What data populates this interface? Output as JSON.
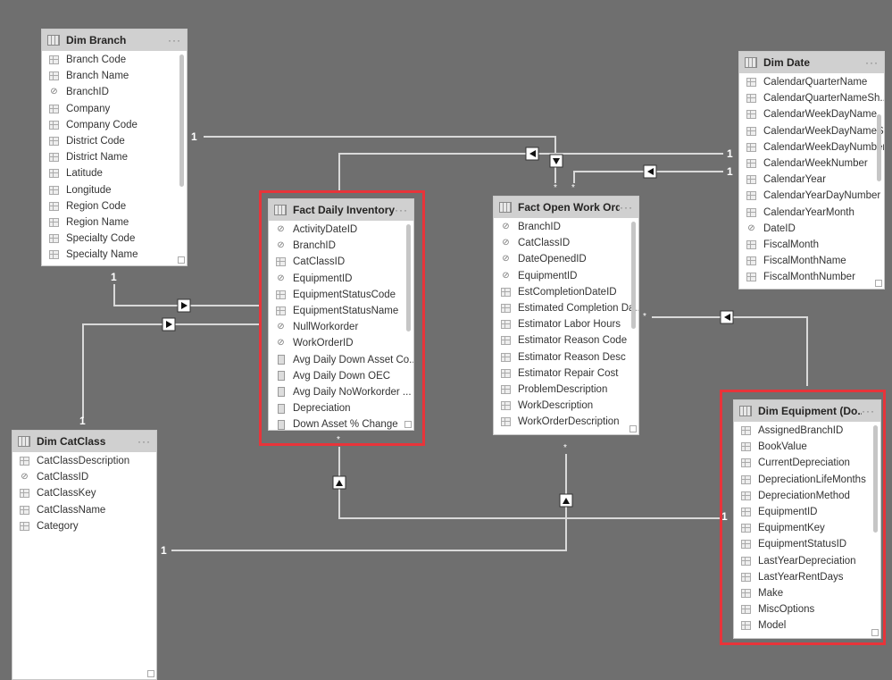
{
  "tables": {
    "dim_branch": {
      "title": "Dim Branch",
      "fields": [
        {
          "name": "Branch Code",
          "icon": "col"
        },
        {
          "name": "Branch Name",
          "icon": "col"
        },
        {
          "name": "BranchID",
          "icon": "hidden"
        },
        {
          "name": "Company",
          "icon": "col"
        },
        {
          "name": "Company Code",
          "icon": "col"
        },
        {
          "name": "District Code",
          "icon": "col"
        },
        {
          "name": "District Name",
          "icon": "col"
        },
        {
          "name": "Latitude",
          "icon": "col"
        },
        {
          "name": "Longitude",
          "icon": "col"
        },
        {
          "name": "Region Code",
          "icon": "col"
        },
        {
          "name": "Region Name",
          "icon": "col"
        },
        {
          "name": "Specialty Code",
          "icon": "col"
        },
        {
          "name": "Specialty Name",
          "icon": "col"
        }
      ]
    },
    "fact_daily_inventory": {
      "title": "Fact Daily Inventory",
      "highlighted": true,
      "fields": [
        {
          "name": "ActivityDateID",
          "icon": "hidden"
        },
        {
          "name": "BranchID",
          "icon": "hidden"
        },
        {
          "name": "CatClassID",
          "icon": "col"
        },
        {
          "name": "EquipmentID",
          "icon": "hidden"
        },
        {
          "name": "EquipmentStatusCode",
          "icon": "col"
        },
        {
          "name": "EquipmentStatusName",
          "icon": "col"
        },
        {
          "name": "NullWorkorder",
          "icon": "hidden"
        },
        {
          "name": "WorkOrderID",
          "icon": "hidden"
        },
        {
          "name": "Avg Daily Down Asset Co...",
          "icon": "measure"
        },
        {
          "name": "Avg Daily Down OEC",
          "icon": "measure"
        },
        {
          "name": "Avg Daily NoWorkorder ...",
          "icon": "measure"
        },
        {
          "name": "Depreciation",
          "icon": "measure"
        },
        {
          "name": "Down Asset % Change",
          "icon": "measure"
        }
      ]
    },
    "fact_open_work_orders": {
      "title": "Fact Open Work Ord...",
      "fields": [
        {
          "name": "BranchID",
          "icon": "hidden"
        },
        {
          "name": "CatClassID",
          "icon": "hidden"
        },
        {
          "name": "DateOpenedID",
          "icon": "hidden"
        },
        {
          "name": "EquipmentID",
          "icon": "hidden"
        },
        {
          "name": "EstCompletionDateID",
          "icon": "col"
        },
        {
          "name": "Estimated Completion Da...",
          "icon": "col"
        },
        {
          "name": "Estimator Labor Hours",
          "icon": "col"
        },
        {
          "name": "Estimator Reason Code",
          "icon": "col"
        },
        {
          "name": "Estimator Reason Desc",
          "icon": "col"
        },
        {
          "name": "Estimator Repair Cost",
          "icon": "col"
        },
        {
          "name": "ProblemDescription",
          "icon": "col"
        },
        {
          "name": "WorkDescription",
          "icon": "col"
        },
        {
          "name": "WorkOrderDescription",
          "icon": "col"
        }
      ]
    },
    "dim_date": {
      "title": "Dim Date",
      "fields": [
        {
          "name": "CalendarQuarterName",
          "icon": "col"
        },
        {
          "name": "CalendarQuarterNameSh...",
          "icon": "col"
        },
        {
          "name": "CalendarWeekDayName",
          "icon": "col"
        },
        {
          "name": "CalendarWeekDayNameS...",
          "icon": "col"
        },
        {
          "name": "CalendarWeekDayNumber",
          "icon": "col"
        },
        {
          "name": "CalendarWeekNumber",
          "icon": "col"
        },
        {
          "name": "CalendarYear",
          "icon": "col"
        },
        {
          "name": "CalendarYearDayNumber",
          "icon": "col"
        },
        {
          "name": "CalendarYearMonth",
          "icon": "col"
        },
        {
          "name": "DateID",
          "icon": "hidden"
        },
        {
          "name": "FiscalMonth",
          "icon": "col"
        },
        {
          "name": "FiscalMonthName",
          "icon": "col"
        },
        {
          "name": "FiscalMonthNumber",
          "icon": "col"
        }
      ]
    },
    "dim_equipment": {
      "title": "Dim Equipment (Do...",
      "highlighted": true,
      "fields": [
        {
          "name": "AssignedBranchID",
          "icon": "col"
        },
        {
          "name": "BookValue",
          "icon": "col"
        },
        {
          "name": "CurrentDepreciation",
          "icon": "col"
        },
        {
          "name": "DepreciationLifeMonths",
          "icon": "col"
        },
        {
          "name": "DepreciationMethod",
          "icon": "col"
        },
        {
          "name": "EquipmentID",
          "icon": "col"
        },
        {
          "name": "EquipmentKey",
          "icon": "col"
        },
        {
          "name": "EquipmentStatusID",
          "icon": "col"
        },
        {
          "name": "LastYearDepreciation",
          "icon": "col"
        },
        {
          "name": "LastYearRentDays",
          "icon": "col"
        },
        {
          "name": "Make",
          "icon": "col"
        },
        {
          "name": "MiscOptions",
          "icon": "col"
        },
        {
          "name": "Model",
          "icon": "col"
        }
      ]
    },
    "dim_catclass": {
      "title": "Dim CatClass",
      "fields": [
        {
          "name": "CatClassDescription",
          "icon": "col"
        },
        {
          "name": "CatClassID",
          "icon": "hidden"
        },
        {
          "name": "CatClassKey",
          "icon": "col"
        },
        {
          "name": "CatClassName",
          "icon": "col"
        },
        {
          "name": "Category",
          "icon": "col"
        }
      ]
    }
  },
  "cardinality": {
    "one": "1",
    "many": "*"
  },
  "more_label": "···",
  "colors": {
    "canvas": "#6f6f6f",
    "highlight": "#e8343a",
    "header": "#d0d0d0"
  }
}
